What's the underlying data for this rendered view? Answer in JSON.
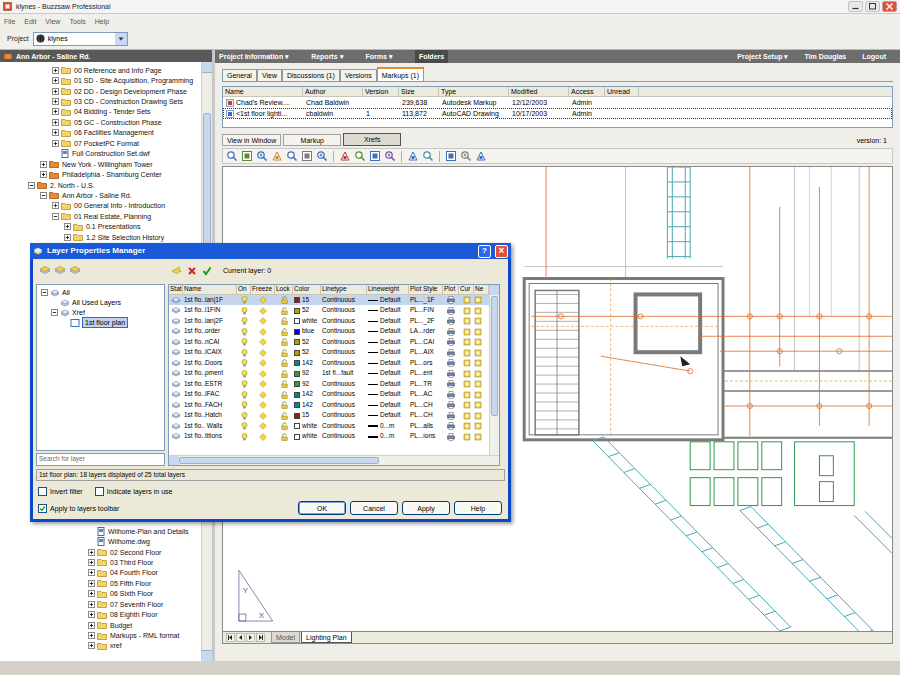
{
  "window": {
    "title": "klynes - Buzzsaw Professional"
  },
  "menu": [
    "File",
    "Edit",
    "View",
    "Tools",
    "Help"
  ],
  "project": {
    "label": "Project",
    "value": "klynes"
  },
  "sidebar": {
    "header": "Ann Arbor - Saline Rd.",
    "items": [
      {
        "label": "00 Reference and Info Page",
        "depth": 2,
        "kind": "folder",
        "expanded": false
      },
      {
        "label": "01 SD - Site Acquisition, Programming",
        "depth": 2,
        "kind": "folder",
        "expanded": false
      },
      {
        "label": "02 DD - Design Development Phase",
        "depth": 2,
        "kind": "folder",
        "expanded": false
      },
      {
        "label": "03 CD - Construction Drawing Sets",
        "depth": 2,
        "kind": "folder",
        "expanded": false
      },
      {
        "label": "04 Bidding - Tender Sets",
        "depth": 2,
        "kind": "folder",
        "expanded": false
      },
      {
        "label": "05 GC - Construction Phase",
        "depth": 2,
        "kind": "folder",
        "expanded": false
      },
      {
        "label": "06 Facilities Management",
        "depth": 2,
        "kind": "folder",
        "expanded": false
      },
      {
        "label": "07 PocketPC Format",
        "depth": 2,
        "kind": "folder",
        "expanded": false
      },
      {
        "label": "Full Construction Set.dwf",
        "depth": 2,
        "kind": "file"
      },
      {
        "label": "New York - Willingham Tower",
        "depth": 1,
        "kind": "project",
        "expanded": false
      },
      {
        "label": "Philadelphia - Shamburg Center",
        "depth": 1,
        "kind": "project",
        "expanded": false
      },
      {
        "label": "2. North - U.S.",
        "depth": 0,
        "kind": "region",
        "expanded": true
      },
      {
        "label": "Ann Arbor - Saline Rd.",
        "depth": 1,
        "kind": "project",
        "expanded": true
      },
      {
        "label": "00 General Info - Introduction",
        "depth": 2,
        "kind": "folder",
        "expanded": false
      },
      {
        "label": "01 Real Estate, Planning",
        "depth": 2,
        "kind": "folder",
        "expanded": true
      },
      {
        "label": "0.1 Presentations",
        "depth": 3,
        "kind": "folder",
        "expanded": false
      },
      {
        "label": "1.2 Site Selection History",
        "depth": 3,
        "kind": "folder",
        "expanded": false
      }
    ],
    "items_below": [
      {
        "label": "Wilhome-Plan and Details",
        "depth": 5,
        "kind": "file"
      },
      {
        "label": "Wilhome.dwg",
        "depth": 5,
        "kind": "file"
      },
      {
        "label": "02 Second Floor",
        "depth": 5,
        "kind": "folder",
        "expanded": false
      },
      {
        "label": "03 Third Floor",
        "depth": 5,
        "kind": "folder",
        "expanded": false
      },
      {
        "label": "04 Fourth Floor",
        "depth": 5,
        "kind": "folder",
        "expanded": false
      },
      {
        "label": "05 Fifth Floor",
        "depth": 5,
        "kind": "folder",
        "expanded": false
      },
      {
        "label": "06 Sixth Floor",
        "depth": 5,
        "kind": "folder",
        "expanded": false
      },
      {
        "label": "07 Seventh Floor",
        "depth": 5,
        "kind": "folder",
        "expanded": false
      },
      {
        "label": "08 Eighth Floor",
        "depth": 5,
        "kind": "folder",
        "expanded": false
      },
      {
        "label": "Budget",
        "depth": 5,
        "kind": "folder",
        "expanded": false
      },
      {
        "label": "Markups - RML format",
        "depth": 5,
        "kind": "folder",
        "expanded": false
      },
      {
        "label": "xref",
        "depth": 5,
        "kind": "folder",
        "expanded": false
      }
    ]
  },
  "nav": {
    "left": [
      {
        "label": "Project Information ▾",
        "selected": false
      },
      {
        "label": "Reports ▾",
        "selected": false
      },
      {
        "label": "Forms ▾",
        "selected": false
      },
      {
        "label": "Folders",
        "selected": true
      }
    ],
    "right": [
      "Project Setup ▾",
      "Tim Douglas",
      "Logout"
    ]
  },
  "tabs": [
    {
      "label": "General",
      "selected": false
    },
    {
      "label": "View",
      "selected": false
    },
    {
      "label": "Discussions (1)",
      "selected": false
    },
    {
      "label": "Versions",
      "selected": false
    },
    {
      "label": "Markups (1)",
      "selected": true
    }
  ],
  "table": {
    "columns": [
      "Name",
      "Author",
      "Version",
      "Size",
      "Type",
      "Modified",
      "Access",
      "Unread"
    ],
    "rows": [
      {
        "cells": [
          "Chad's Review....",
          "Chad Baldwin",
          "",
          "239,638",
          "Autodesk Markup",
          "12/12/2003",
          "Admin",
          ""
        ],
        "kind": "markup",
        "selected": false
      },
      {
        "cells": [
          "<1st floor lighti...",
          "cbaldwin",
          "1",
          "113,872",
          "AutoCAD Drawing",
          "10/17/2003",
          "Admin",
          ""
        ],
        "kind": "drawing",
        "selected": true
      }
    ]
  },
  "viewer": {
    "tabs": [
      {
        "label": "View in Window",
        "selected": false
      },
      {
        "label": "Markup",
        "selected": false
      },
      {
        "label": "Xrefs",
        "selected": true
      }
    ],
    "version": "version: 1"
  },
  "layout_tabs": [
    {
      "label": "Model",
      "selected": false
    },
    {
      "label": "Lighting Plan",
      "selected": true
    }
  ],
  "ucs": {
    "x": "X",
    "y": "Y"
  },
  "dialog": {
    "title": "Layer Properties Manager",
    "title_buttons": [
      {
        "label": "?",
        "kind": "help"
      },
      {
        "label": "×",
        "kind": "close"
      }
    ],
    "current_layer": "Current layer: 0",
    "tree": [
      {
        "label": "All",
        "depth": 0,
        "kind": "group",
        "expanded": true,
        "selected": false
      },
      {
        "label": "All Used Layers",
        "depth": 1,
        "kind": "filter",
        "selected": false
      },
      {
        "label": "Xref",
        "depth": 1,
        "kind": "group",
        "expanded": true,
        "selected": false
      },
      {
        "label": "1st floor plan",
        "depth": 2,
        "kind": "drawing",
        "selected": true
      }
    ],
    "columns": [
      "Stat",
      "Name",
      "On",
      "Freeze",
      "Lock",
      "Color",
      "Linetype",
      "Lineweight",
      "Plot Style",
      "Plot",
      "Cur",
      "Ne"
    ],
    "layers": [
      {
        "name": "1st flo..lan|1F",
        "color_label": "15",
        "color": "#8b2500",
        "linetype": "Continuous",
        "lineweight": "Default",
        "heavy": false,
        "plot_style": "PL..._1F",
        "on": true,
        "frozen": false,
        "locked": false,
        "plot": true,
        "selected": true
      },
      {
        "name": "1st flo..l1FIN",
        "color_label": "52",
        "color": "#b8a000",
        "linetype": "Continuous",
        "lineweight": "Default",
        "heavy": false,
        "plot_style": "PL...FIN",
        "on": true,
        "frozen": false,
        "locked": false,
        "plot": true,
        "selected": false
      },
      {
        "name": "1st flo..lan|2F",
        "color_label": "white",
        "color": "#ffffff",
        "linetype": "Continuous",
        "lineweight": "Default",
        "heavy": false,
        "plot_style": "PL..._2F",
        "on": true,
        "frozen": false,
        "locked": false,
        "plot": true,
        "selected": false
      },
      {
        "name": "1st flo..order",
        "color_label": "blue",
        "color": "#0000ff",
        "linetype": "Continuous",
        "lineweight": "Default",
        "heavy": false,
        "plot_style": "LA...rder",
        "on": true,
        "frozen": false,
        "locked": false,
        "plot": true,
        "selected": false
      },
      {
        "name": "1st flo..nCAI",
        "color_label": "52",
        "color": "#b8a000",
        "linetype": "Continuous",
        "lineweight": "Default",
        "heavy": false,
        "plot_style": "PL...CAI",
        "on": true,
        "frozen": false,
        "locked": false,
        "plot": true,
        "selected": false
      },
      {
        "name": "1st flo..ICAIX",
        "color_label": "52",
        "color": "#b8a000",
        "linetype": "Continuous",
        "lineweight": "Default",
        "heavy": false,
        "plot_style": "PL...AIX",
        "on": true,
        "frozen": false,
        "locked": false,
        "plot": true,
        "selected": false
      },
      {
        "name": "1st flo..Doors",
        "color_label": "142",
        "color": "#008b8b",
        "linetype": "Continuous",
        "lineweight": "Default",
        "heavy": false,
        "plot_style": "PL...ors",
        "on": true,
        "frozen": false,
        "locked": false,
        "plot": true,
        "selected": false
      },
      {
        "name": "1st flo..pment",
        "color_label": "92",
        "color": "#3a9a3a",
        "linetype": "1st fl...fault",
        "lineweight": "Default",
        "heavy": false,
        "plot_style": "PL...ent",
        "on": true,
        "frozen": false,
        "locked": false,
        "plot": true,
        "selected": false
      },
      {
        "name": "1st flo..ESTR",
        "color_label": "92",
        "color": "#3a9a3a",
        "linetype": "Continuous",
        "lineweight": "Default",
        "heavy": false,
        "plot_style": "PL...TR",
        "on": true,
        "frozen": false,
        "locked": false,
        "plot": true,
        "selected": false
      },
      {
        "name": "1st flo..IFAC",
        "color_label": "142",
        "color": "#008b8b",
        "linetype": "Continuous",
        "lineweight": "Default",
        "heavy": false,
        "plot_style": "PL...AC",
        "on": true,
        "frozen": false,
        "locked": false,
        "plot": true,
        "selected": false
      },
      {
        "name": "1st flo..FACH",
        "color_label": "142",
        "color": "#008b8b",
        "linetype": "Continuous",
        "lineweight": "Default",
        "heavy": false,
        "plot_style": "PL...CH",
        "on": true,
        "frozen": false,
        "locked": false,
        "plot": true,
        "selected": false
      },
      {
        "name": "1st flo..Hatch",
        "color_label": "15",
        "color": "#8b2500",
        "linetype": "Continuous",
        "lineweight": "Default",
        "heavy": false,
        "plot_style": "PL...CH",
        "on": true,
        "frozen": false,
        "locked": false,
        "plot": true,
        "selected": false
      },
      {
        "name": "1st flo.. Walls",
        "color_label": "white",
        "color": "#ffffff",
        "linetype": "Continuous",
        "lineweight": "0...m",
        "heavy": true,
        "plot_style": "PL...alls",
        "on": true,
        "frozen": false,
        "locked": false,
        "plot": true,
        "selected": false
      },
      {
        "name": "1st flo..titions",
        "color_label": "white",
        "color": "#ffffff",
        "linetype": "Continuous",
        "lineweight": "0...m",
        "heavy": true,
        "plot_style": "PL...ions",
        "on": true,
        "frozen": false,
        "locked": false,
        "plot": true,
        "selected": false
      }
    ],
    "search": {
      "placeholder": "Search for layer"
    },
    "status": "1st floor plan: 18 layers displayed of 25 total layers",
    "checkboxes": [
      {
        "label": "Invert filter",
        "checked": false
      },
      {
        "label": "Indicate layers in use",
        "checked": false
      },
      {
        "label": "Apply to layers toolbar",
        "checked": true
      }
    ],
    "buttons": [
      "OK",
      "Cancel",
      "Apply",
      "Help"
    ]
  }
}
